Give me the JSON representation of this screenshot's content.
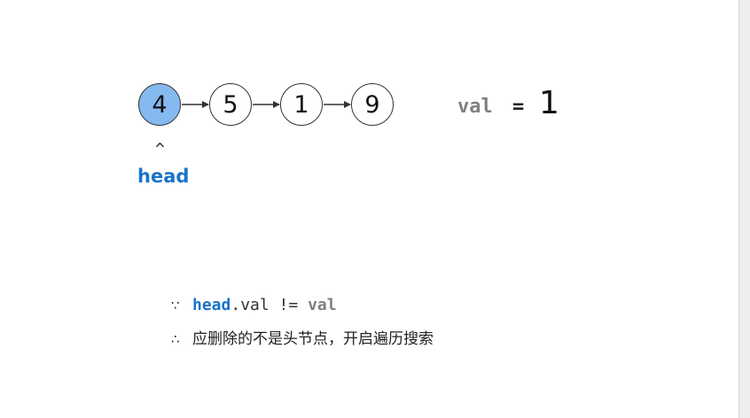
{
  "list": {
    "nodes": [
      "4",
      "5",
      "1",
      "9"
    ],
    "head_index": 0,
    "colors": {
      "head_fill": "#85b9f0",
      "node_fill": "#ffffff",
      "stroke": "#333333",
      "head_label": "#1a73c9",
      "val_label": "#808080"
    }
  },
  "pointer": {
    "caret": "^",
    "label": "head"
  },
  "target": {
    "label": "val",
    "equals": "=",
    "value": "1"
  },
  "explanation": {
    "line1": {
      "symbol": "∵",
      "head_word": "head",
      "rest": ".val != ",
      "val_word": "val"
    },
    "line2": {
      "symbol": "∴",
      "text": "应删除的不是头节点，开启遍历搜索"
    }
  }
}
